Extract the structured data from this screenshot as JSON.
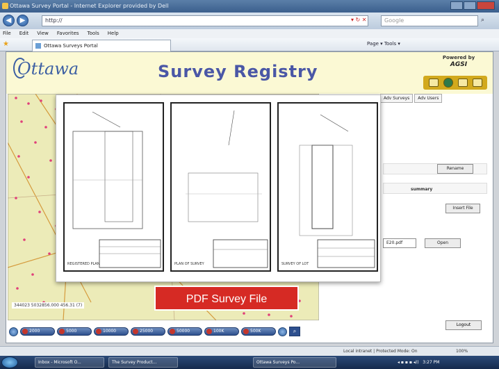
{
  "browser": {
    "title": "Ottawa Survey Portal - Internet Explorer provided by Dell",
    "address": "http://",
    "search_placeholder": "Google",
    "menu": [
      "File",
      "Edit",
      "View",
      "Favorites",
      "Tools",
      "Help"
    ],
    "tab_title": "Ottawa Surveys Portal",
    "command_bar": "Page ▾  Tools ▾",
    "status_left": "Local intranet | Protected Mode: On",
    "status_zoom": "100%"
  },
  "banner": {
    "logo": "Ottawa",
    "title": "Survey Registry",
    "powered_by": "Powered by",
    "vendor": "AGSI"
  },
  "side_panel": {
    "tabs": [
      "Adv Surveys",
      "Adv Users"
    ],
    "rename_button": "Rename",
    "summary_label": "summary",
    "insert_button": "Insert File",
    "file_value": "E20.pdf",
    "open_button": "Open",
    "logout_button": "Logout"
  },
  "map": {
    "coordinates": "344023  5032856.000  456.31 (7)",
    "zoom_levels": [
      "2000",
      "5000",
      "10000",
      "25000",
      "50000",
      "100K",
      "500K"
    ]
  },
  "overlay": {
    "sheet_labels": [
      "REGISTERED PLAN",
      "PLAN OF SURVEY",
      "SURVEY OF LOT"
    ]
  },
  "caption": "PDF Survey File",
  "taskbar": {
    "items": [
      "Inbox - Microsoft O...",
      "The Survey Product...",
      "Ottawa Surveys Po..."
    ],
    "clock": "3:27 PM"
  },
  "colors": {
    "banner_bg": "#fbf9d4",
    "title_blue": "#4a57a6",
    "caption_red": "#d62a24",
    "map_bg": "#ecebb8"
  }
}
